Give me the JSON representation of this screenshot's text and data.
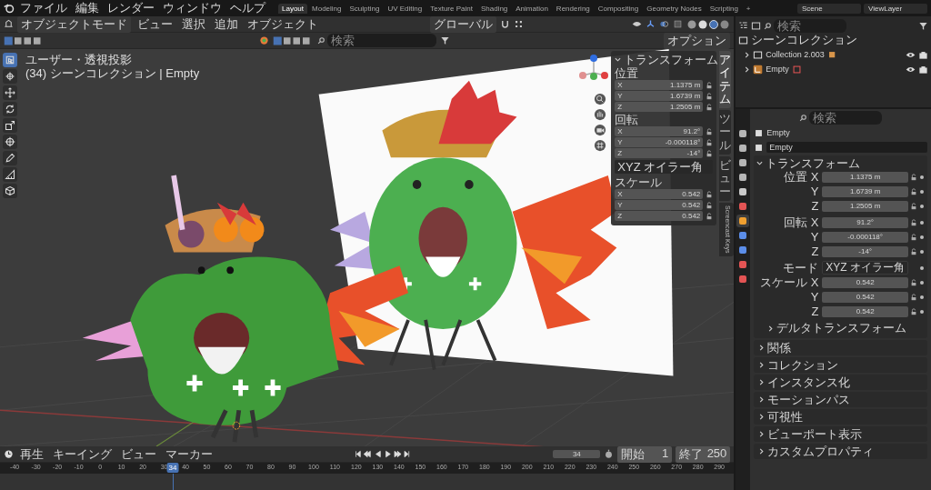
{
  "menu": [
    "ファイル",
    "編集",
    "レンダー",
    "ウィンドウ",
    "ヘルプ"
  ],
  "workspaces": [
    {
      "label": "Layout",
      "selected": true
    },
    {
      "label": "Modeling",
      "selected": false
    },
    {
      "label": "Sculpting",
      "selected": false
    },
    {
      "label": "UV Editing",
      "selected": false
    },
    {
      "label": "Texture Paint",
      "selected": false
    },
    {
      "label": "Shading",
      "selected": false
    },
    {
      "label": "Animation",
      "selected": false
    },
    {
      "label": "Rendering",
      "selected": false
    },
    {
      "label": "Compositing",
      "selected": false
    },
    {
      "label": "Geometry Nodes",
      "selected": false
    },
    {
      "label": "Scripting",
      "selected": false
    }
  ],
  "add_workspace": "+",
  "scene": "Scene",
  "view_layer": "ViewLayer",
  "viewport": {
    "mode": "オブジェクトモード",
    "menus": [
      "ビュー",
      "選択",
      "追加",
      "オブジェクト"
    ],
    "orientation": "グローバル",
    "options": "オプション",
    "search_placeholder": "検索",
    "overlay": [
      "ユーザー・透視投影",
      "(34) シーンコレクション | Empty"
    ],
    "tools": [
      {
        "kind": "select",
        "selected": true
      },
      {
        "kind": "cursor",
        "selected": false
      },
      {
        "kind": "move",
        "selected": false
      },
      {
        "kind": "rotate",
        "selected": false
      },
      {
        "kind": "scale",
        "selected": false
      },
      {
        "kind": "transform",
        "selected": false
      },
      {
        "kind": "annotate",
        "selected": false
      },
      {
        "kind": "measure",
        "selected": false
      },
      {
        "kind": "add",
        "selected": false
      }
    ]
  },
  "sidebar": {
    "title": "トランスフォーム",
    "expanded": true,
    "groups": [
      {
        "label": "位置",
        "fields": [
          {
            "axis": "X",
            "value": "1.1375 m"
          },
          {
            "axis": "Y",
            "value": "1.6739 m"
          },
          {
            "axis": "Z",
            "value": "1.2505 m"
          }
        ]
      },
      {
        "label": "回転",
        "fields": [
          {
            "axis": "X",
            "value": "91.2°"
          },
          {
            "axis": "Y",
            "value": "-0.000118°"
          },
          {
            "axis": "Z",
            "value": "-14°"
          }
        ],
        "mode": "XYZ オイラー角"
      },
      {
        "label": "スケール",
        "fields": [
          {
            "axis": "X",
            "value": "0.542"
          },
          {
            "axis": "Y",
            "value": "0.542"
          },
          {
            "axis": "Z",
            "value": "0.542"
          }
        ]
      }
    ],
    "tabs": [
      {
        "label": "アイテム",
        "selected": true,
        "kind": "cjk"
      },
      {
        "label": "ツール",
        "selected": false,
        "kind": "cjk"
      },
      {
        "label": "ビュー",
        "selected": false,
        "kind": "cjk"
      },
      {
        "label": "Screencast Keys",
        "selected": false,
        "kind": "latin"
      }
    ]
  },
  "outliner": {
    "search_placeholder": "検索",
    "title": "シーンコレクション",
    "items": [
      {
        "kind": "collection",
        "label": "Collection 2.003",
        "expanded": false
      },
      {
        "kind": "empty",
        "label": "Empty",
        "expanded": false
      }
    ]
  },
  "properties": {
    "search_placeholder": "検索",
    "object": "Empty",
    "data_name": "Empty",
    "tabs": [
      {
        "kind": "tool",
        "selected": false
      },
      {
        "kind": "render",
        "selected": false
      },
      {
        "kind": "output",
        "selected": false
      },
      {
        "kind": "view-layer",
        "selected": false
      },
      {
        "kind": "scene",
        "selected": false
      },
      {
        "kind": "world",
        "selected": false
      },
      {
        "kind": "object",
        "selected": true
      },
      {
        "kind": "modifier",
        "selected": false
      },
      {
        "kind": "physics",
        "selected": false
      },
      {
        "kind": "constraint",
        "selected": false
      },
      {
        "kind": "data",
        "selected": false
      }
    ],
    "transform_title": "トランスフォーム",
    "transform_expanded": true,
    "groups": [
      {
        "label": "位置",
        "fields": [
          {
            "axis": "X",
            "value": "1.1375 m"
          },
          {
            "axis": "Y",
            "value": "1.6739 m"
          },
          {
            "axis": "Z",
            "value": "1.2505 m"
          }
        ]
      },
      {
        "label": "回転",
        "fields": [
          {
            "axis": "X",
            "value": "91.2°"
          },
          {
            "axis": "Y",
            "value": "-0.000118°"
          },
          {
            "axis": "Z",
            "value": "-14°"
          }
        ],
        "mode_label": "モード",
        "mode": "XYZ オイラー角"
      },
      {
        "label": "スケール",
        "fields": [
          {
            "axis": "X",
            "value": "0.542"
          },
          {
            "axis": "Y",
            "value": "0.542"
          },
          {
            "axis": "Z",
            "value": "0.542"
          }
        ]
      }
    ],
    "subsection": {
      "label": "デルタトランスフォーム",
      "expanded": false
    },
    "sections": [
      {
        "label": "関係",
        "expanded": false
      },
      {
        "label": "コレクション",
        "expanded": false
      },
      {
        "label": "インスタンス化",
        "expanded": false
      },
      {
        "label": "モーションパス",
        "expanded": false
      },
      {
        "label": "可視性",
        "expanded": false
      },
      {
        "label": "ビューポート表示",
        "expanded": false
      },
      {
        "label": "カスタムプロパティ",
        "expanded": false
      }
    ]
  },
  "timeline": {
    "menus": [
      "再生",
      "キーイング",
      "ビュー",
      "マーカー"
    ],
    "current": "34",
    "start_label": "開始",
    "start": "1",
    "end_label": "終了",
    "end": "250",
    "playhead": "34",
    "ticks": [
      "-40",
      "-30",
      "-20",
      "-10",
      "0",
      "10",
      "20",
      "30",
      "40",
      "50",
      "60",
      "70",
      "80",
      "90",
      "100",
      "110",
      "120",
      "130",
      "140",
      "150",
      "160",
      "170",
      "180",
      "190",
      "200",
      "210",
      "220",
      "230",
      "240",
      "250",
      "260",
      "270",
      "280",
      "290"
    ]
  }
}
